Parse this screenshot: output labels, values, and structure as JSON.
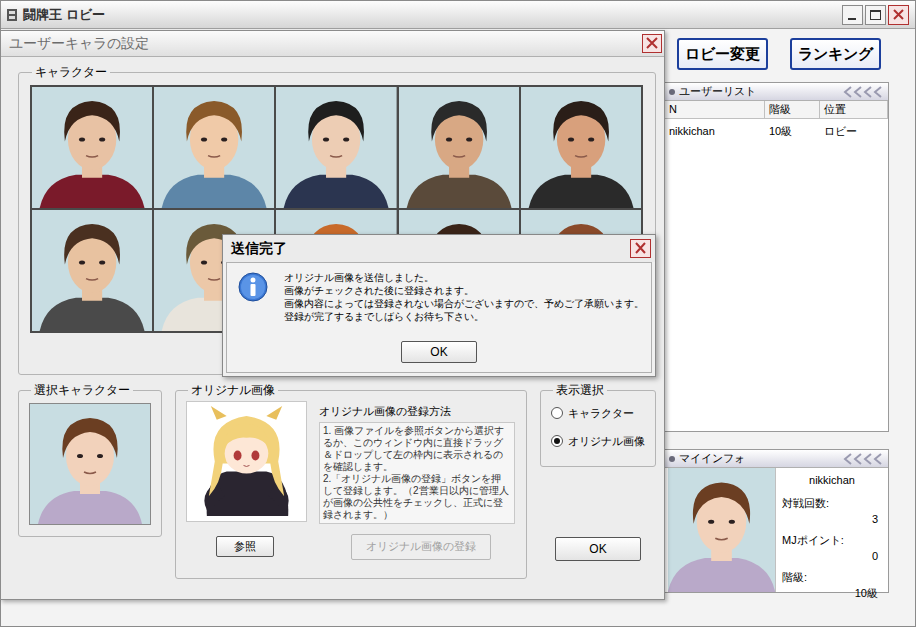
{
  "main_window": {
    "title": "闘牌王 ロビー"
  },
  "lobby": {
    "buttons": [
      "ロビー変更",
      "ランキング"
    ],
    "user_list": {
      "title": "ユーザーリスト",
      "columns": [
        "N",
        "階級",
        "位置"
      ],
      "rows": [
        [
          "nikkichan",
          "10級",
          "ロビー"
        ]
      ]
    },
    "my_info": {
      "title": "マイインフォ",
      "name": "nikkichan",
      "stats": [
        {
          "label": "対戦回数:",
          "value": "3"
        },
        {
          "label": "MJポイント:",
          "value": "0"
        },
        {
          "label": "階級:",
          "value": "10級"
        }
      ]
    }
  },
  "dialog": {
    "title": "ユーザーキャラの設定",
    "character_group": "キャラクター",
    "selected_group": "選択キャラクター",
    "original_image": {
      "title": "オリジナル画像",
      "heading": "オリジナル画像の登録方法",
      "steps": [
        "1. 画像ファイルを参照ボタンから選択するか、このウィンドウ内に直接ドラッグ＆ドロップして左の枠内に表示されるのを確認します。",
        "2.「オリジナル画像の登録」ボタンを押して登録します。（2営業日以内に管理人が画像の公共性をチェックし、正式に登録されます。）"
      ],
      "browse_button": "参照",
      "register_button": {
        "label": "オリジナル画像の登録",
        "disabled": true
      }
    },
    "display": {
      "title": "表示選択",
      "options": [
        {
          "label": "キャラクター",
          "selected": false
        },
        {
          "label": "オリジナル画像",
          "selected": true
        }
      ]
    },
    "ok_button": "OK"
  },
  "message_box": {
    "title": "送信完了",
    "lines": [
      "オリジナル画像を送信しました。",
      "画像がチェックされた後に登録されます。",
      "画像内容によっては登録されない場合がございますので、予めご了承願います。",
      "登録が完了するまでしばらくお待ち下さい。"
    ],
    "button": "OK"
  }
}
